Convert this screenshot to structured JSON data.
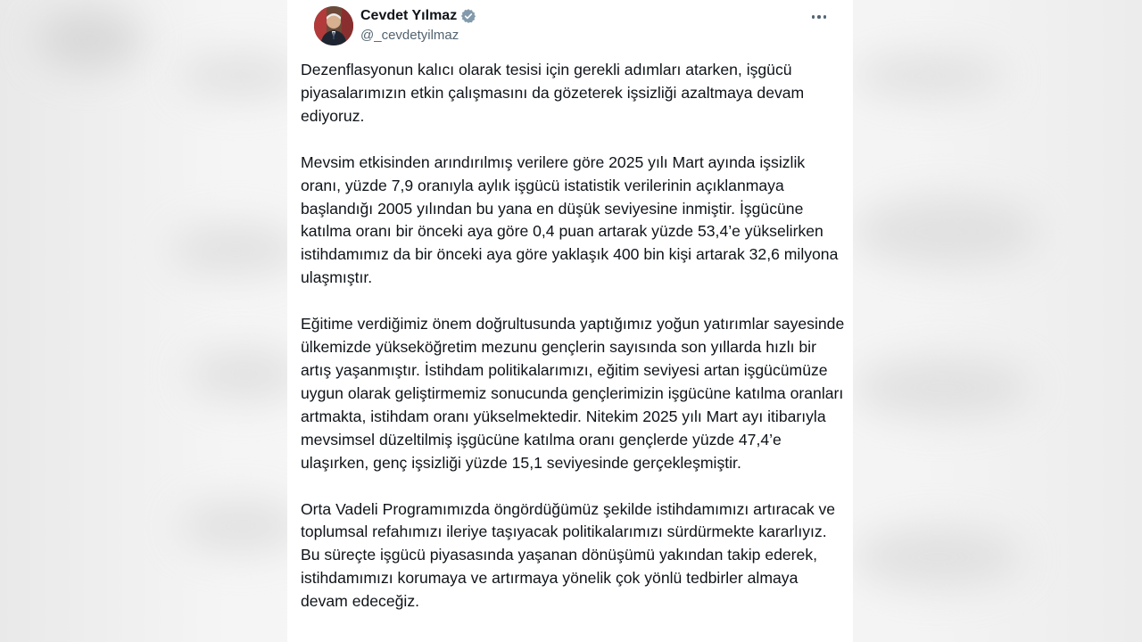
{
  "author": {
    "name": "Cevdet Yılmaz",
    "handle": "@_cevdetyilmaz",
    "verified_color": "#829aab"
  },
  "icons": {
    "more": "more-horizontal-icon",
    "verified": "verified-badge-icon"
  },
  "tweet": {
    "paragraphs": [
      "Dezenflasyonun kalıcı olarak tesisi için gerekli adımları atarken, işgücü piyasalarımızın etkin çalışmasını da gözeterek işsizliği azaltmaya devam ediyoruz.",
      "Mevsim etkisinden arındırılmış verilere göre 2025 yılı Mart ayında işsizlik oranı, yüzde 7,9 oranıyla aylık işgücü istatistik verilerinin açıklanmaya başlandığı 2005 yılından bu yana en düşük seviyesine inmiştir. İşgücüne katılma oranı bir önceki aya göre 0,4 puan artarak yüzde 53,4’e yükselirken istihdamımız da bir önceki aya göre yaklaşık 400 bin kişi artarak 32,6 milyona ulaşmıştır.",
      "Eğitime verdiğimiz önem doğrultusunda yaptığımız yoğun yatırımlar sayesinde ülkemizde yükseköğretim mezunu gençlerin sayısında son yıllarda hızlı bir artış yaşanmıştır. İstihdam politikalarımızı, eğitim seviyesi artan işgücümüze uygun olarak geliştirmemiz sonucunda gençlerimizin işgücüne katılma oranları artmakta, istihdam oranı yükselmektedir. Nitekim 2025 yılı Mart ayı itibarıyla mevsimsel düzeltilmiş işgücüne katılma oranı gençlerde yüzde 47,4’e ulaşırken, genç işsizliği yüzde 15,1 seviyesinde gerçekleşmiştir.",
      "Orta Vadeli Programımızda öngördüğümüz şekilde istihdamımızı artıracak ve toplumsal refahımızı ileriye taşıyacak politikalarımızı sürdürmekte kararlıyız. Bu süreçte işgücü piyasasında yaşanan dönüşümü yakından takip ederek, istihdamımızı korumaya ve artırmaya yönelik çok yönlü tedbirler almaya devam edeceğiz."
    ]
  }
}
